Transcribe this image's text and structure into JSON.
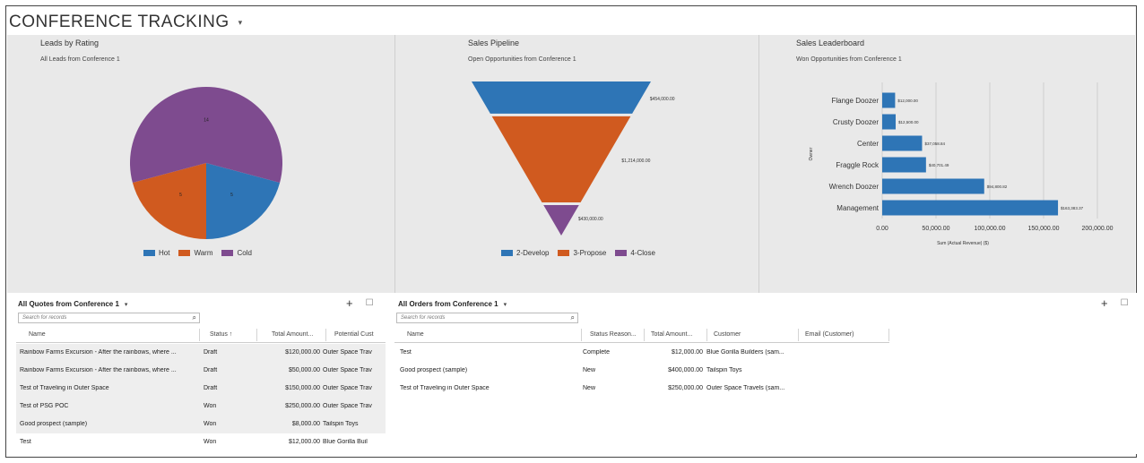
{
  "dashboard": {
    "title": "CONFERENCE TRACKING"
  },
  "leads": {
    "title": "Leads by Rating",
    "subtitle": "All Leads from Conference 1",
    "chart_data": {
      "type": "pie",
      "title": "Leads by Rating",
      "subtitle": "All Leads from Conference 1",
      "labels": [
        "Hot",
        "Warm",
        "Cold"
      ],
      "values": [
        5,
        5,
        14
      ],
      "colors": [
        "#2e75b6",
        "#d05a1f",
        "#7e4b8f"
      ],
      "legend_position": "bottom"
    }
  },
  "pipeline": {
    "title": "Sales Pipeline",
    "subtitle": "Open Opportunities from Conference 1",
    "chart_data": {
      "type": "funnel",
      "title": "Sales Pipeline",
      "subtitle": "Open Opportunities from Conference 1",
      "stages": [
        "2-Develop",
        "3-Propose",
        "4-Close"
      ],
      "values": [
        454000,
        1214000,
        430000
      ],
      "labels": [
        "$454,000.00",
        "$1,214,000.00",
        "$430,000.00"
      ],
      "colors": [
        "#2e75b6",
        "#d05a1f",
        "#7e4b8f"
      ],
      "legend_position": "bottom"
    }
  },
  "leaderboard": {
    "title": "Sales Leaderboard",
    "subtitle": "Won Opportunities from Conference 1",
    "chart_data": {
      "type": "bar",
      "orientation": "horizontal",
      "title": "Sales Leaderboard",
      "subtitle": "Won Opportunities from Conference 1",
      "categories": [
        "Flange Doozer",
        "Crusty Doozer",
        "Center",
        "Fraggle Rock",
        "Wrench Doozer",
        "Management"
      ],
      "values": [
        12000,
        12500,
        37058.84,
        40701.49,
        94800.82,
        163383.37
      ],
      "value_labels": [
        "$12,000.00",
        "$12,500.00",
        "$37,058.84",
        "$40,701.49",
        "$94,800.82",
        "$163,383.37"
      ],
      "xlim": [
        0,
        200000
      ],
      "xticks": [
        "0.00",
        "50,000.00",
        "100,000.00",
        "150,000.00",
        "200,000.00"
      ],
      "xlabel": "Sum (Actual Revenue) ($)",
      "ylabel": "Owner",
      "color": "#2e75b6",
      "grid": true
    }
  },
  "quotes": {
    "title": "All Quotes from Conference 1",
    "search_placeholder": "Search for records",
    "columns": [
      "Name",
      "Status ↑",
      "Total Amount...",
      "Potential Cust"
    ],
    "rows": [
      [
        "Rainbow Farms Excursion - After the rainbows, where ...",
        "Draft",
        "$120,000.00",
        "Outer Space Trav"
      ],
      [
        "Rainbow Farms Excursion - After the rainbows, where ...",
        "Draft",
        "$50,000.00",
        "Outer Space Trav"
      ],
      [
        "Test of Traveling in Outer Space",
        "Draft",
        "$150,000.00",
        "Outer Space Trav"
      ],
      [
        "Test of PSG POC",
        "Won",
        "$250,000.00",
        "Outer Space Trav"
      ],
      [
        "Good prospect (sample)",
        "Won",
        "$8,000.00",
        "Tailspin Toys"
      ],
      [
        "Test",
        "Won",
        "$12,000.00",
        "Blue Gorilla Buil"
      ]
    ]
  },
  "orders": {
    "title": "All Orders from Conference 1",
    "search_placeholder": "Search for records",
    "columns": [
      "Name",
      "Status Reason...",
      "Total Amount...",
      "Customer",
      "Email (Customer)"
    ],
    "rows": [
      [
        "Test",
        "Complete",
        "$12,000.00",
        "Blue Gorilla Builders (sam..."
      ],
      [
        "Good prospect (sample)",
        "New",
        "$400,000.00",
        "Tailspin Toys"
      ],
      [
        "Test of Traveling in Outer Space",
        "New",
        "$250,000.00",
        "Outer Space Travels (sam..."
      ]
    ]
  },
  "icons": {
    "add": "+",
    "toggle": "☐",
    "search": "⌕",
    "chevron": "▾"
  }
}
